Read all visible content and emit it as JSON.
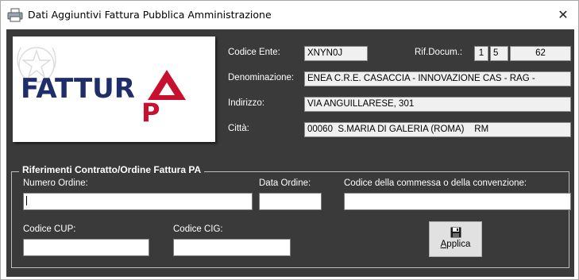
{
  "window": {
    "title": "Dati Aggiuntivi Fattura Pubblica Amministrazione",
    "close_glyph": "✕",
    "app_icon": "printer-icon"
  },
  "logo": {
    "text_main": "FATTUR",
    "text_a": "A",
    "text_p": "P",
    "colors": {
      "navy": "#1f2d6b",
      "red": "#c8102e"
    },
    "emblem": "italian-republic-emblem"
  },
  "ente": {
    "codice_ente_label": "Codice Ente:",
    "codice_ente_value": "XNYN0J",
    "rif_docum_label": "Rif.Docum.:",
    "rif_docum_1": "1",
    "rif_docum_2": "5",
    "rif_docum_3": "62",
    "denominazione_label": "Denominazione:",
    "denominazione_value": "ENEA C.R.E. CASACCIA - INNOVAZIONE CAS - RAG -",
    "indirizzo_label": "Indirizzo:",
    "indirizzo_value": "VIA ANGUILLARESE, 301",
    "citta_label": "Città:",
    "citta_value": "00060  S.MARIA DI GALERIA (ROMA)    RM"
  },
  "riferimenti": {
    "group_title": "Riferimenti Contratto/Ordine Fattura PA",
    "numero_ordine_label": "Numero Ordine:",
    "numero_ordine_value": "",
    "data_ordine_label": "Data Ordine:",
    "data_ordine_value": "",
    "codice_commessa_label": "Codice della commessa o della convenzione:",
    "codice_commessa_value": "",
    "codice_cup_label": "Codice CUP:",
    "codice_cup_value": "",
    "codice_cig_label": "Codice CIG:",
    "codice_cig_value": "",
    "applica_first": "A",
    "applica_rest": "pplica",
    "applica_icon": "floppy-disk-icon"
  },
  "colors": {
    "panel_bg": "#3a3a3a",
    "label_text": "#ffffff"
  }
}
